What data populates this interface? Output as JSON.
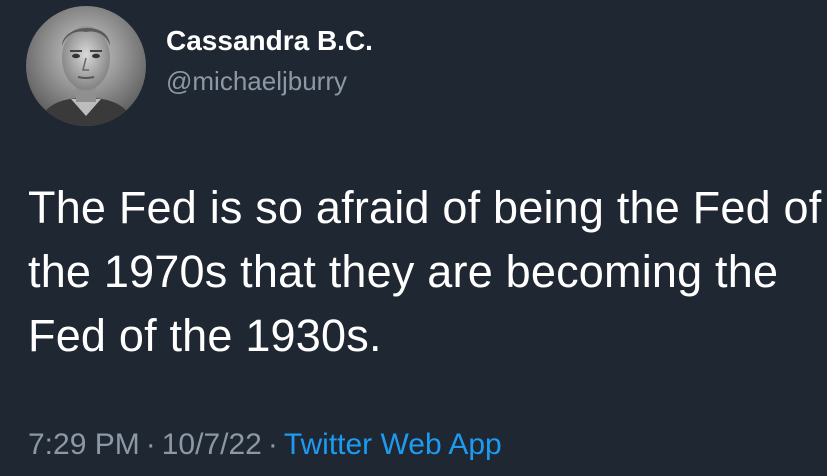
{
  "author": {
    "display_name": "Cassandra B.C.",
    "handle": "@michaeljburry",
    "avatar_icon": "profile-photo-grayscale"
  },
  "tweet": {
    "text": "The Fed is so afraid of being the Fed of the 1970s that they are becoming the Fed of the 1930s."
  },
  "meta": {
    "time": "7:29 PM",
    "separator": "·",
    "date": "10/7/22",
    "source": "Twitter Web App"
  },
  "colors": {
    "background": "#1f2732",
    "text": "#ffffff",
    "secondary": "#8b98a5",
    "link": "#1d9bf0"
  }
}
